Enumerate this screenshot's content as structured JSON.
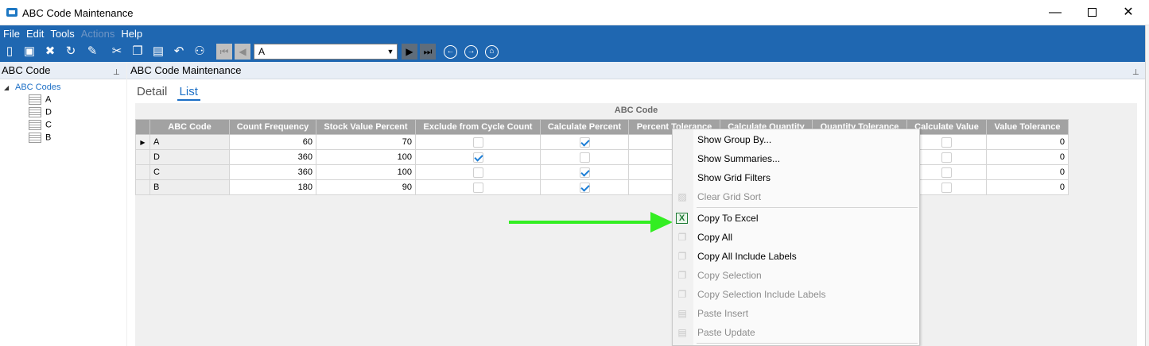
{
  "window": {
    "title": "ABC Code Maintenance",
    "min_glyph": "—",
    "close_glyph": "✕"
  },
  "menu": [
    "File",
    "Edit",
    "Tools",
    "Actions",
    "Help"
  ],
  "menu_disabled": [
    "Actions"
  ],
  "toolbar": {
    "icons": [
      "new-icon",
      "save-icon",
      "delete-icon",
      "refresh-icon",
      "clear-icon",
      "cut-icon",
      "copy-icon",
      "paste-icon",
      "undo-icon",
      "binoculars-icon",
      "first-record-icon",
      "previous-record-icon",
      "next-record-icon",
      "last-record-icon",
      "back-icon",
      "forward-icon",
      "home-icon"
    ],
    "record_combo_value": "A"
  },
  "left_panel": {
    "title": "ABC Code",
    "tree_root": "ABC Codes",
    "tree_items": [
      "A",
      "D",
      "C",
      "B"
    ]
  },
  "main_panel": {
    "title": "ABC Code Maintenance",
    "tabs": [
      "Detail",
      "List"
    ],
    "active_tab": "List"
  },
  "grid": {
    "caption": "ABC Code",
    "columns": [
      "ABC Code",
      "Count Frequency",
      "Stock Value Percent",
      "Exclude from Cycle Count",
      "Calculate Percent",
      "Percent Tolerance",
      "Calculate Quantity",
      "Quantity Tolerance",
      "Calculate Value",
      "Value Tolerance"
    ],
    "rows": [
      {
        "code": "A",
        "count_frequency": "60",
        "stock_value_percent": "70",
        "exclude": false,
        "calc_percent": true,
        "calc_value": false,
        "value_tolerance": "0"
      },
      {
        "code": "D",
        "count_frequency": "360",
        "stock_value_percent": "100",
        "exclude": true,
        "calc_percent": false,
        "calc_value": false,
        "value_tolerance": "0"
      },
      {
        "code": "C",
        "count_frequency": "360",
        "stock_value_percent": "100",
        "exclude": false,
        "calc_percent": true,
        "calc_value": false,
        "value_tolerance": "0"
      },
      {
        "code": "B",
        "count_frequency": "180",
        "stock_value_percent": "90",
        "exclude": false,
        "calc_percent": true,
        "calc_value": false,
        "value_tolerance": "0"
      }
    ],
    "current_row_marker": "▶"
  },
  "context_menu": {
    "items": [
      {
        "label": "Show Group By...",
        "enabled": true,
        "icon": ""
      },
      {
        "label": "Show Summaries...",
        "enabled": true,
        "icon": ""
      },
      {
        "label": "Show Grid Filters",
        "enabled": true,
        "icon": ""
      },
      {
        "label": "Clear Grid Sort",
        "enabled": false,
        "icon": "clear-sort-icon"
      },
      {
        "label": "Copy To Excel",
        "enabled": true,
        "icon": "excel-icon"
      },
      {
        "label": "Copy All",
        "enabled": true,
        "icon": "copy-icon"
      },
      {
        "label": "Copy All Include Labels",
        "enabled": true,
        "icon": "copy-icon"
      },
      {
        "label": "Copy Selection",
        "enabled": false,
        "icon": "copy-icon"
      },
      {
        "label": "Copy Selection Include Labels",
        "enabled": false,
        "icon": "copy-icon"
      },
      {
        "label": "Paste Insert",
        "enabled": false,
        "icon": "paste-icon"
      },
      {
        "label": "Paste Update",
        "enabled": false,
        "icon": "paste-icon"
      }
    ]
  },
  "colors": {
    "band": "#1f67b1",
    "grid_header": "#a2a2a2",
    "link": "#1c6fc6",
    "annotation_arrow": "#33ee22"
  }
}
